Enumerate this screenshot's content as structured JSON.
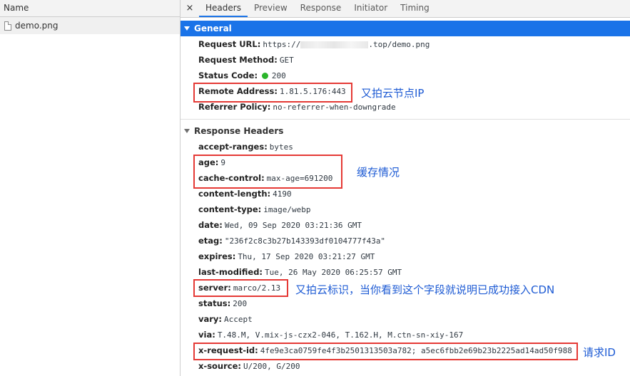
{
  "left": {
    "column_header": "Name",
    "files": [
      {
        "name": "demo.png"
      }
    ]
  },
  "tabs": {
    "close_symbol": "×",
    "items": [
      {
        "label": "Headers"
      },
      {
        "label": "Preview"
      },
      {
        "label": "Response"
      },
      {
        "label": "Initiator"
      },
      {
        "label": "Timing"
      }
    ]
  },
  "general": {
    "title": "General",
    "rows": [
      {
        "key": "Request URL:",
        "value_prefix": "https://",
        "value_suffix": ".top/demo.png"
      },
      {
        "key": "Request Method:",
        "value": "GET"
      },
      {
        "key": "Status Code:",
        "value": "200"
      },
      {
        "key": "Remote Address:",
        "value": "1.81.5.176:443"
      },
      {
        "key": "Referrer Policy:",
        "value": "no-referrer-when-downgrade"
      }
    ]
  },
  "response": {
    "title": "Response Headers",
    "rows": [
      {
        "key": "accept-ranges:",
        "value": "bytes"
      },
      {
        "key": "age:",
        "value": "9"
      },
      {
        "key": "cache-control:",
        "value": "max-age=691200"
      },
      {
        "key": "content-length:",
        "value": "4190"
      },
      {
        "key": "content-type:",
        "value": "image/webp"
      },
      {
        "key": "date:",
        "value": "Wed, 09 Sep 2020 03:21:36 GMT"
      },
      {
        "key": "etag:",
        "value": "\"236f2c8c3b27b143393df0104777f43a\""
      },
      {
        "key": "expires:",
        "value": "Thu, 17 Sep 2020 03:21:27 GMT"
      },
      {
        "key": "last-modified:",
        "value": "Tue, 26 May 2020 06:25:57 GMT"
      },
      {
        "key": "server:",
        "value": "marco/2.13"
      },
      {
        "key": "status:",
        "value": "200"
      },
      {
        "key": "vary:",
        "value": "Accept"
      },
      {
        "key": "via:",
        "value": "T.48.M, V.mix-js-czx2-046, T.162.H, M.ctn-sn-xiy-167"
      },
      {
        "key": "x-request-id:",
        "value": "4fe9e3ca0759fe4f3b2501313503a782; a5ec6fbb2e69b23b2225ad14ad50f988"
      },
      {
        "key": "x-source:",
        "value": "U/200, G/200"
      }
    ]
  },
  "annotations": {
    "remote": "又拍云节点IP",
    "cache": "缓存情况",
    "server": "又拍云标识，当你看到这个字段就说明已成功接入CDN",
    "request_id": "请求ID"
  },
  "colors": {
    "accent": "#1a73e8",
    "annotation_box": "#e53935",
    "annotation_text": "#1e5bd4",
    "status_ok": "#2ab52a"
  }
}
